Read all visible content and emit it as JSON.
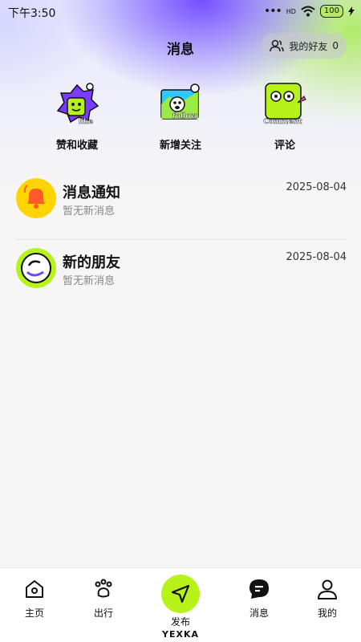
{
  "status": {
    "time": "下午3:50",
    "network": "HD",
    "battery": "100"
  },
  "header": {
    "title": "消息",
    "friends_label": "我的好友",
    "friends_count": "0"
  },
  "quick_actions": [
    {
      "label": "赞和收藏",
      "badge": "like",
      "icon": "like-mascot-icon"
    },
    {
      "label": "新增关注",
      "badge": "follow",
      "icon": "follow-mascot-icon"
    },
    {
      "label": "评论",
      "badge": "Comment",
      "icon": "comment-mascot-icon"
    }
  ],
  "messages": [
    {
      "title": "消息通知",
      "subtitle": "暂无新消息",
      "date": "2025-08-04",
      "icon": "bell-icon"
    },
    {
      "title": "新的朋友",
      "subtitle": "暂无新消息",
      "date": "2025-08-04",
      "icon": "smiley-icon"
    }
  ],
  "tabs": {
    "home": "主页",
    "travel": "出行",
    "publish": "发布",
    "brand": "YEXKA",
    "messages": "消息",
    "mine": "我的"
  },
  "colors": {
    "accent": "#b7f21a",
    "purple": "#6e46ff",
    "bell_bg": "#ffd400",
    "bell": "#ff5a2a"
  }
}
